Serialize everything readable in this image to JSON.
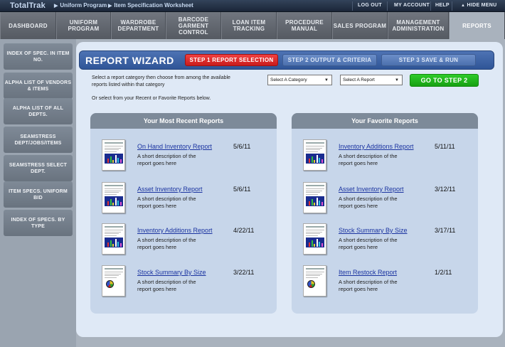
{
  "app": {
    "brand": "TotalTrak"
  },
  "breadcrumb": [
    "Uniform Program",
    "Item Specification Worksheet"
  ],
  "toplinks": {
    "logout": "LOG OUT",
    "account": "MY ACCOUNT",
    "help": "HELP",
    "hide_menu": "HIDE MENU"
  },
  "nav": [
    {
      "label": "DASHBOARD"
    },
    {
      "label": "UNIFORM PROGRAM"
    },
    {
      "label": "WARDROBE DEPARTMENT"
    },
    {
      "label": "BARCODE GARMENT CONTROL"
    },
    {
      "label": "LOAN ITEM TRACKING"
    },
    {
      "label": "PROCEDURE MANUAL"
    },
    {
      "label": "SALES PROGRAM"
    },
    {
      "label": "MANAGEMENT ADMINISTRATION"
    },
    {
      "label": "REPORTS",
      "active": true
    }
  ],
  "sidebar": [
    {
      "label": "INDEX OF SPEC. IN ITEM NO."
    },
    {
      "label": "ALPHA LIST OF VENDORS & ITEMS"
    },
    {
      "label": "ALPHA LIST OF ALL DEPTS."
    },
    {
      "label": "SEAMSTRESS DEPT/JOBS/ITEMS"
    },
    {
      "label": "SEAMSTRESS SELECT DEPT."
    },
    {
      "label": "ITEM SPECS. UNIFORM BID"
    },
    {
      "label": "INDEX OF SPECS. BY TYPE"
    }
  ],
  "wizard": {
    "title": "REPORT WIZARD",
    "steps": [
      "STEP 1 REPORT SELECTION",
      "STEP 2 OUTPUT & CRITERIA",
      "STEP 3 SAVE & RUN"
    ],
    "instruction_line1": "Select a report category then choose from among the available",
    "instruction_line2": "reports listed within that category",
    "instruction_line3": "Or select from your Recent or Favorite Reports below.",
    "category_select": "Select A Category",
    "report_select": "Select A Report",
    "go_button": "GO TO STEP 2"
  },
  "recent": {
    "title": "Your Most Recent Reports",
    "items": [
      {
        "name": "On Hand Inventory Report",
        "date": "5/6/11",
        "desc1": "A short description of the",
        "desc2": "report goes here",
        "thumb": "bar"
      },
      {
        "name": "Asset Inventory Report",
        "date": "5/6/11",
        "desc1": "A short description of the",
        "desc2": "report goes here",
        "thumb": "bar"
      },
      {
        "name": "Inventory Additions Report",
        "date": "4/22/11",
        "desc1": "A short description of the",
        "desc2": "report goes here",
        "thumb": "bar"
      },
      {
        "name": "Stock Summary By Size",
        "date": "3/22/11",
        "desc1": "A short description of the",
        "desc2": "report goes here",
        "thumb": "pie"
      }
    ]
  },
  "favorite": {
    "title": "Your Favorite Reports",
    "items": [
      {
        "name": "Inventory Additions Report",
        "date": "5/11/11",
        "desc1": "A short description of the",
        "desc2": "report goes here",
        "thumb": "bar"
      },
      {
        "name": "Asset Inventory Report",
        "date": "3/12/11",
        "desc1": "A short description of the",
        "desc2": "report goes here",
        "thumb": "bar"
      },
      {
        "name": "Stock Summary By Size",
        "date": "3/17/11",
        "desc1": "A short description of the",
        "desc2": "report goes here",
        "thumb": "bar"
      },
      {
        "name": "Item Restock Report",
        "date": "1/2/11",
        "desc1": "A short description of the",
        "desc2": "report goes here",
        "thumb": "pie"
      }
    ]
  }
}
